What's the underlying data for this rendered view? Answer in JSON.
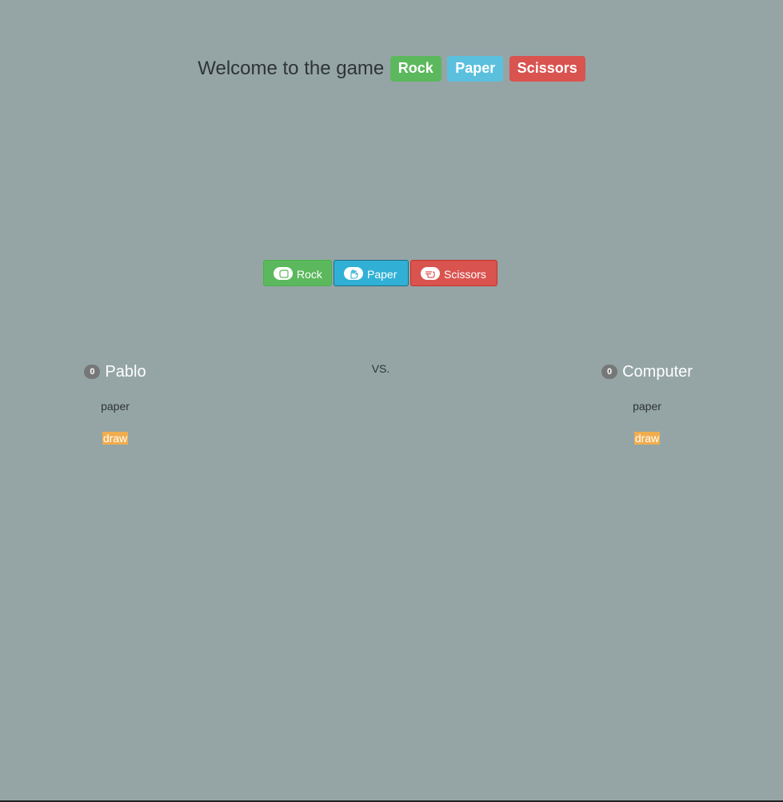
{
  "header": {
    "welcome_text": "Welcome to the game",
    "labels": [
      "Rock",
      "Paper",
      "Scissors"
    ]
  },
  "choices": {
    "rock_label": "Rock",
    "paper_label": "Paper",
    "scissors_label": "Scissors",
    "rock_icon": "hand-rock-icon",
    "paper_icon": "hand-paper-icon",
    "scissors_icon": "hand-scissors-icon"
  },
  "players": {
    "left": {
      "name": "Pablo",
      "score": "0",
      "choice": "paper",
      "result": "draw"
    },
    "right": {
      "name": "Computer",
      "score": "0",
      "choice": "paper",
      "result": "draw"
    }
  },
  "vs_text": "VS.",
  "colors": {
    "background": "#95a5a6",
    "rock": "#5cb85c",
    "paper": "#5bc0de",
    "scissors": "#d9534f",
    "result": "#f0ad4e",
    "badge": "#777777"
  }
}
